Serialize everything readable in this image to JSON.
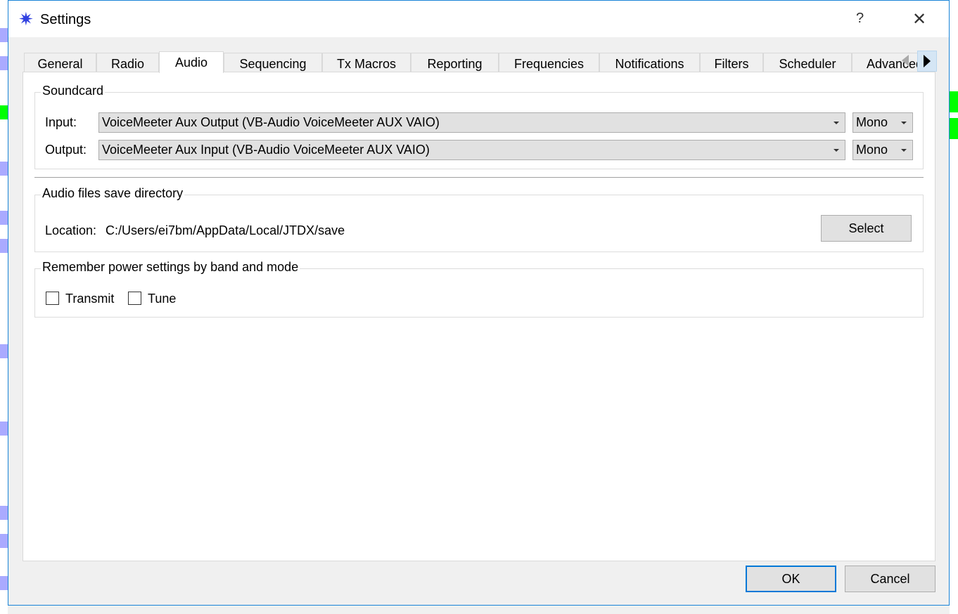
{
  "dialog": {
    "title": "Settings",
    "app_icon": "compass-star-icon",
    "help_label": "?",
    "close_label": "✕"
  },
  "tabs": [
    {
      "label": "General"
    },
    {
      "label": "Radio"
    },
    {
      "label": "Audio",
      "selected": true
    },
    {
      "label": "Sequencing"
    },
    {
      "label": "Tx Macros"
    },
    {
      "label": "Reporting"
    },
    {
      "label": "Frequencies"
    },
    {
      "label": "Notifications"
    },
    {
      "label": "Filters"
    },
    {
      "label": "Scheduler"
    },
    {
      "label": "Advanced"
    }
  ],
  "soundcard": {
    "title": "Soundcard",
    "input_label": "Input:",
    "input_value": "VoiceMeeter Aux Output (VB-Audio VoiceMeeter AUX VAIO)",
    "input_channel": "Mono",
    "output_label": "Output:",
    "output_value": "VoiceMeeter Aux Input (VB-Audio VoiceMeeter AUX VAIO)",
    "output_channel": "Mono"
  },
  "save_dir": {
    "title": "Audio files save directory",
    "location_label": "Location:",
    "location_value": "C:/Users/ei7bm/AppData/Local/JTDX/save",
    "select_label": "Select"
  },
  "power": {
    "title": "Remember power settings by band and mode",
    "transmit_label": "Transmit",
    "transmit_checked": false,
    "tune_label": "Tune",
    "tune_checked": false
  },
  "footer": {
    "ok_label": "OK",
    "cancel_label": "Cancel"
  },
  "colors": {
    "accent": "#0078d7",
    "title_icon": "#3040e0"
  }
}
